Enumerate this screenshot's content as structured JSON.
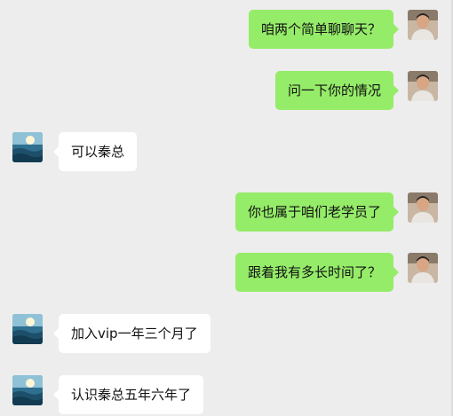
{
  "messages": [
    {
      "side": "right",
      "text": "咱两个简单聊聊天？"
    },
    {
      "side": "right",
      "text": "问一下你的情况"
    },
    {
      "side": "left",
      "text": "可以秦总"
    },
    {
      "side": "right",
      "text": "你也属于咱们老学员了"
    },
    {
      "side": "right",
      "text": "跟着我有多长时间了？"
    },
    {
      "side": "left",
      "text": "加入vip一年三个月了"
    },
    {
      "side": "left",
      "text": "认识秦总五年六年了"
    }
  ],
  "colors": {
    "background": "#ededed",
    "outgoing_bubble": "#95ec69",
    "incoming_bubble": "#ffffff"
  },
  "icons": {
    "self_avatar": "man-portrait-avatar",
    "contact_avatar": "ocean-scenery-avatar"
  }
}
